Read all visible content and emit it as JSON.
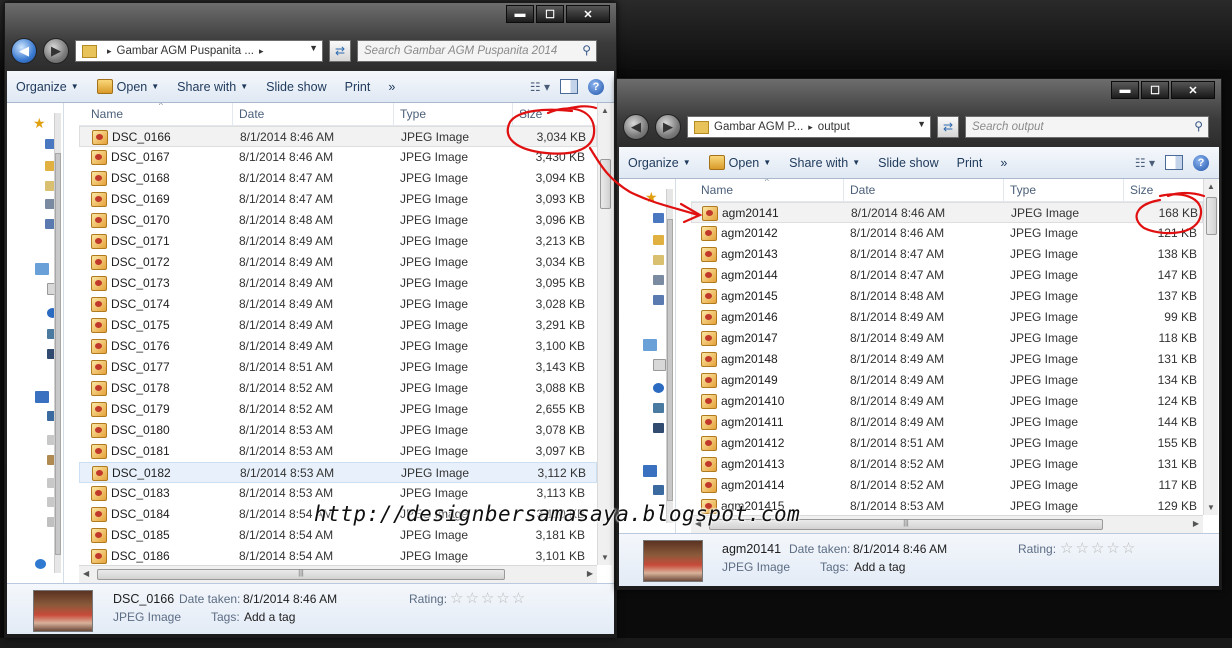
{
  "left": {
    "caption": {
      "min": "▬",
      "max": "☐",
      "close": "✕"
    },
    "address": {
      "crumb": "Gambar AGM Puspanita ...",
      "arrow": "▸"
    },
    "search_placeholder": "Search Gambar AGM Puspanita 2014",
    "toolbar": {
      "organize": "Organize",
      "open": "Open",
      "share": "Share with",
      "slideshow": "Slide show",
      "print": "Print",
      "more": "»"
    },
    "columns": {
      "name": "Name",
      "date": "Date",
      "type": "Type",
      "size": "Size"
    },
    "files": [
      {
        "name": "DSC_0166",
        "date": "8/1/2014 8:46 AM",
        "type": "JPEG Image",
        "size": "3,034 KB"
      },
      {
        "name": "DSC_0167",
        "date": "8/1/2014 8:46 AM",
        "type": "JPEG Image",
        "size": "3,430 KB"
      },
      {
        "name": "DSC_0168",
        "date": "8/1/2014 8:47 AM",
        "type": "JPEG Image",
        "size": "3,094 KB"
      },
      {
        "name": "DSC_0169",
        "date": "8/1/2014 8:47 AM",
        "type": "JPEG Image",
        "size": "3,093 KB"
      },
      {
        "name": "DSC_0170",
        "date": "8/1/2014 8:48 AM",
        "type": "JPEG Image",
        "size": "3,096 KB"
      },
      {
        "name": "DSC_0171",
        "date": "8/1/2014 8:49 AM",
        "type": "JPEG Image",
        "size": "3,213 KB"
      },
      {
        "name": "DSC_0172",
        "date": "8/1/2014 8:49 AM",
        "type": "JPEG Image",
        "size": "3,034 KB"
      },
      {
        "name": "DSC_0173",
        "date": "8/1/2014 8:49 AM",
        "type": "JPEG Image",
        "size": "3,095 KB"
      },
      {
        "name": "DSC_0174",
        "date": "8/1/2014 8:49 AM",
        "type": "JPEG Image",
        "size": "3,028 KB"
      },
      {
        "name": "DSC_0175",
        "date": "8/1/2014 8:49 AM",
        "type": "JPEG Image",
        "size": "3,291 KB"
      },
      {
        "name": "DSC_0176",
        "date": "8/1/2014 8:49 AM",
        "type": "JPEG Image",
        "size": "3,100 KB"
      },
      {
        "name": "DSC_0177",
        "date": "8/1/2014 8:51 AM",
        "type": "JPEG Image",
        "size": "3,143 KB"
      },
      {
        "name": "DSC_0178",
        "date": "8/1/2014 8:52 AM",
        "type": "JPEG Image",
        "size": "3,088 KB"
      },
      {
        "name": "DSC_0179",
        "date": "8/1/2014 8:52 AM",
        "type": "JPEG Image",
        "size": "2,655 KB"
      },
      {
        "name": "DSC_0180",
        "date": "8/1/2014 8:53 AM",
        "type": "JPEG Image",
        "size": "3,078 KB"
      },
      {
        "name": "DSC_0181",
        "date": "8/1/2014 8:53 AM",
        "type": "JPEG Image",
        "size": "3,097 KB"
      },
      {
        "name": "DSC_0182",
        "date": "8/1/2014 8:53 AM",
        "type": "JPEG Image",
        "size": "3,112 KB"
      },
      {
        "name": "DSC_0183",
        "date": "8/1/2014 8:53 AM",
        "type": "JPEG Image",
        "size": "3,113 KB"
      },
      {
        "name": "DSC_0184",
        "date": "8/1/2014 8:54 AM",
        "type": "JPEG Image",
        "size": "3,110 KB"
      },
      {
        "name": "DSC_0185",
        "date": "8/1/2014 8:54 AM",
        "type": "JPEG Image",
        "size": "3,181 KB"
      },
      {
        "name": "DSC_0186",
        "date": "8/1/2014 8:54 AM",
        "type": "JPEG Image",
        "size": "3,101 KB"
      }
    ],
    "details": {
      "name": "DSC_0166",
      "type": "JPEG Image",
      "date_label": "Date taken:",
      "date_value": "8/1/2014 8:46 AM",
      "tags_label": "Tags:",
      "tags_value": "Add a tag",
      "rating_label": "Rating:",
      "stars": "☆☆☆☆☆"
    }
  },
  "right": {
    "caption": {
      "min": "▬",
      "max": "☐",
      "close": "✕"
    },
    "address": {
      "crumb1": "Gambar AGM P...",
      "arrow": "▸",
      "crumb2": "output"
    },
    "search_placeholder": "Search output",
    "toolbar": {
      "organize": "Organize",
      "open": "Open",
      "share": "Share with",
      "slideshow": "Slide show",
      "print": "Print",
      "more": "»"
    },
    "columns": {
      "name": "Name",
      "date": "Date",
      "type": "Type",
      "size": "Size"
    },
    "files": [
      {
        "name": "agm20141",
        "date": "8/1/2014 8:46 AM",
        "type": "JPEG Image",
        "size": "168 KB"
      },
      {
        "name": "agm20142",
        "date": "8/1/2014 8:46 AM",
        "type": "JPEG Image",
        "size": "121 KB"
      },
      {
        "name": "agm20143",
        "date": "8/1/2014 8:47 AM",
        "type": "JPEG Image",
        "size": "138 KB"
      },
      {
        "name": "agm20144",
        "date": "8/1/2014 8:47 AM",
        "type": "JPEG Image",
        "size": "147 KB"
      },
      {
        "name": "agm20145",
        "date": "8/1/2014 8:48 AM",
        "type": "JPEG Image",
        "size": "137 KB"
      },
      {
        "name": "agm20146",
        "date": "8/1/2014 8:49 AM",
        "type": "JPEG Image",
        "size": "99 KB"
      },
      {
        "name": "agm20147",
        "date": "8/1/2014 8:49 AM",
        "type": "JPEG Image",
        "size": "118 KB"
      },
      {
        "name": "agm20148",
        "date": "8/1/2014 8:49 AM",
        "type": "JPEG Image",
        "size": "131 KB"
      },
      {
        "name": "agm20149",
        "date": "8/1/2014 8:49 AM",
        "type": "JPEG Image",
        "size": "134 KB"
      },
      {
        "name": "agm201410",
        "date": "8/1/2014 8:49 AM",
        "type": "JPEG Image",
        "size": "124 KB"
      },
      {
        "name": "agm201411",
        "date": "8/1/2014 8:49 AM",
        "type": "JPEG Image",
        "size": "144 KB"
      },
      {
        "name": "agm201412",
        "date": "8/1/2014 8:51 AM",
        "type": "JPEG Image",
        "size": "155 KB"
      },
      {
        "name": "agm201413",
        "date": "8/1/2014 8:52 AM",
        "type": "JPEG Image",
        "size": "131 KB"
      },
      {
        "name": "agm201414",
        "date": "8/1/2014 8:52 AM",
        "type": "JPEG Image",
        "size": "117 KB"
      },
      {
        "name": "agm201415",
        "date": "8/1/2014 8:53 AM",
        "type": "JPEG Image",
        "size": "129 KB"
      }
    ],
    "details": {
      "name": "agm20141",
      "type": "JPEG Image",
      "date_label": "Date taken:",
      "date_value": "8/1/2014 8:46 AM",
      "tags_label": "Tags:",
      "tags_value": "Add a tag",
      "rating_label": "Rating:",
      "stars": "☆☆☆☆☆"
    }
  },
  "watermark": "http://designbersamasaya.blogspot.com",
  "annotation_color": "#e01010"
}
